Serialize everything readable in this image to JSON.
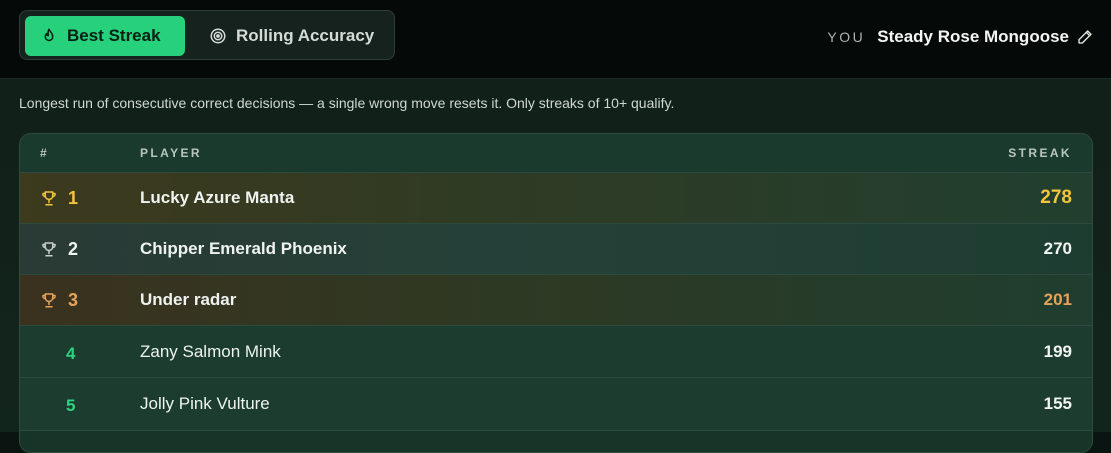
{
  "tabs": [
    {
      "label": "Best Streak",
      "icon": "flame-icon",
      "active": true
    },
    {
      "label": "Rolling Accuracy",
      "icon": "target-icon",
      "active": false
    }
  ],
  "user": {
    "label": "YOU",
    "name": "Steady Rose Mongoose",
    "edit_icon": "pencil-icon"
  },
  "description": "Longest run of consecutive correct decisions — a single wrong move resets it. Only streaks of 10+ qualify.",
  "table": {
    "columns": {
      "rank": "#",
      "player": "PLAYER",
      "streak": "STREAK"
    },
    "rows": [
      {
        "rank": "1",
        "player": "Lucky Azure Manta",
        "streak": "278",
        "medal": "gold"
      },
      {
        "rank": "2",
        "player": "Chipper Emerald Phoenix",
        "streak": "270",
        "medal": "silver"
      },
      {
        "rank": "3",
        "player": "Under radar",
        "streak": "201",
        "medal": "bronze"
      },
      {
        "rank": "4",
        "player": "Zany Salmon Mink",
        "streak": "199",
        "medal": ""
      },
      {
        "rank": "5",
        "player": "Jolly Pink Vulture",
        "streak": "155",
        "medal": ""
      }
    ]
  },
  "colors": {
    "accent": "#27d07a",
    "gold": "#f2c53d",
    "silver": "#c9cfcc",
    "bronze": "#e8a35a",
    "rank_default": "#2fd27f"
  }
}
